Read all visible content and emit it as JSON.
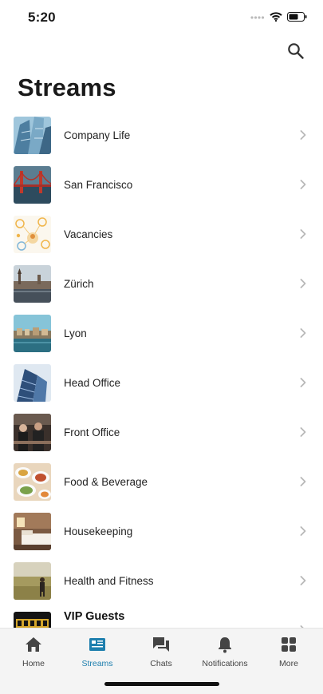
{
  "status_bar": {
    "time": "5:20"
  },
  "header": {
    "title": "Streams",
    "search_icon": "search-icon"
  },
  "streams": [
    {
      "label": "Company Life",
      "thumb": "office-towers-photo"
    },
    {
      "label": "San Francisco",
      "thumb": "golden-gate-photo"
    },
    {
      "label": "Vacancies",
      "thumb": "network-people-illustration"
    },
    {
      "label": "Zürich",
      "thumb": "zurich-river-photo"
    },
    {
      "label": "Lyon",
      "thumb": "lyon-riverside-photo"
    },
    {
      "label": "Head Office",
      "thumb": "glass-building-photo"
    },
    {
      "label": "Front Office",
      "thumb": "reception-staff-photo"
    },
    {
      "label": "Food & Beverage",
      "thumb": "dishes-table-photo"
    },
    {
      "label": "Housekeeping",
      "thumb": "hotel-room-photo"
    },
    {
      "label": "Health and Fitness",
      "thumb": "field-hiker-photo"
    },
    {
      "label": "VIP Guests",
      "thumb": "vip-sign-photo"
    }
  ],
  "tabbar": {
    "active": "Streams",
    "active_color": "#1e7fae",
    "tabs": [
      {
        "label": "Home",
        "icon": "home-icon"
      },
      {
        "label": "Streams",
        "icon": "streams-icon"
      },
      {
        "label": "Chats",
        "icon": "chat-icon"
      },
      {
        "label": "Notifications",
        "icon": "bell-icon"
      },
      {
        "label": "More",
        "icon": "grid-icon"
      }
    ]
  }
}
